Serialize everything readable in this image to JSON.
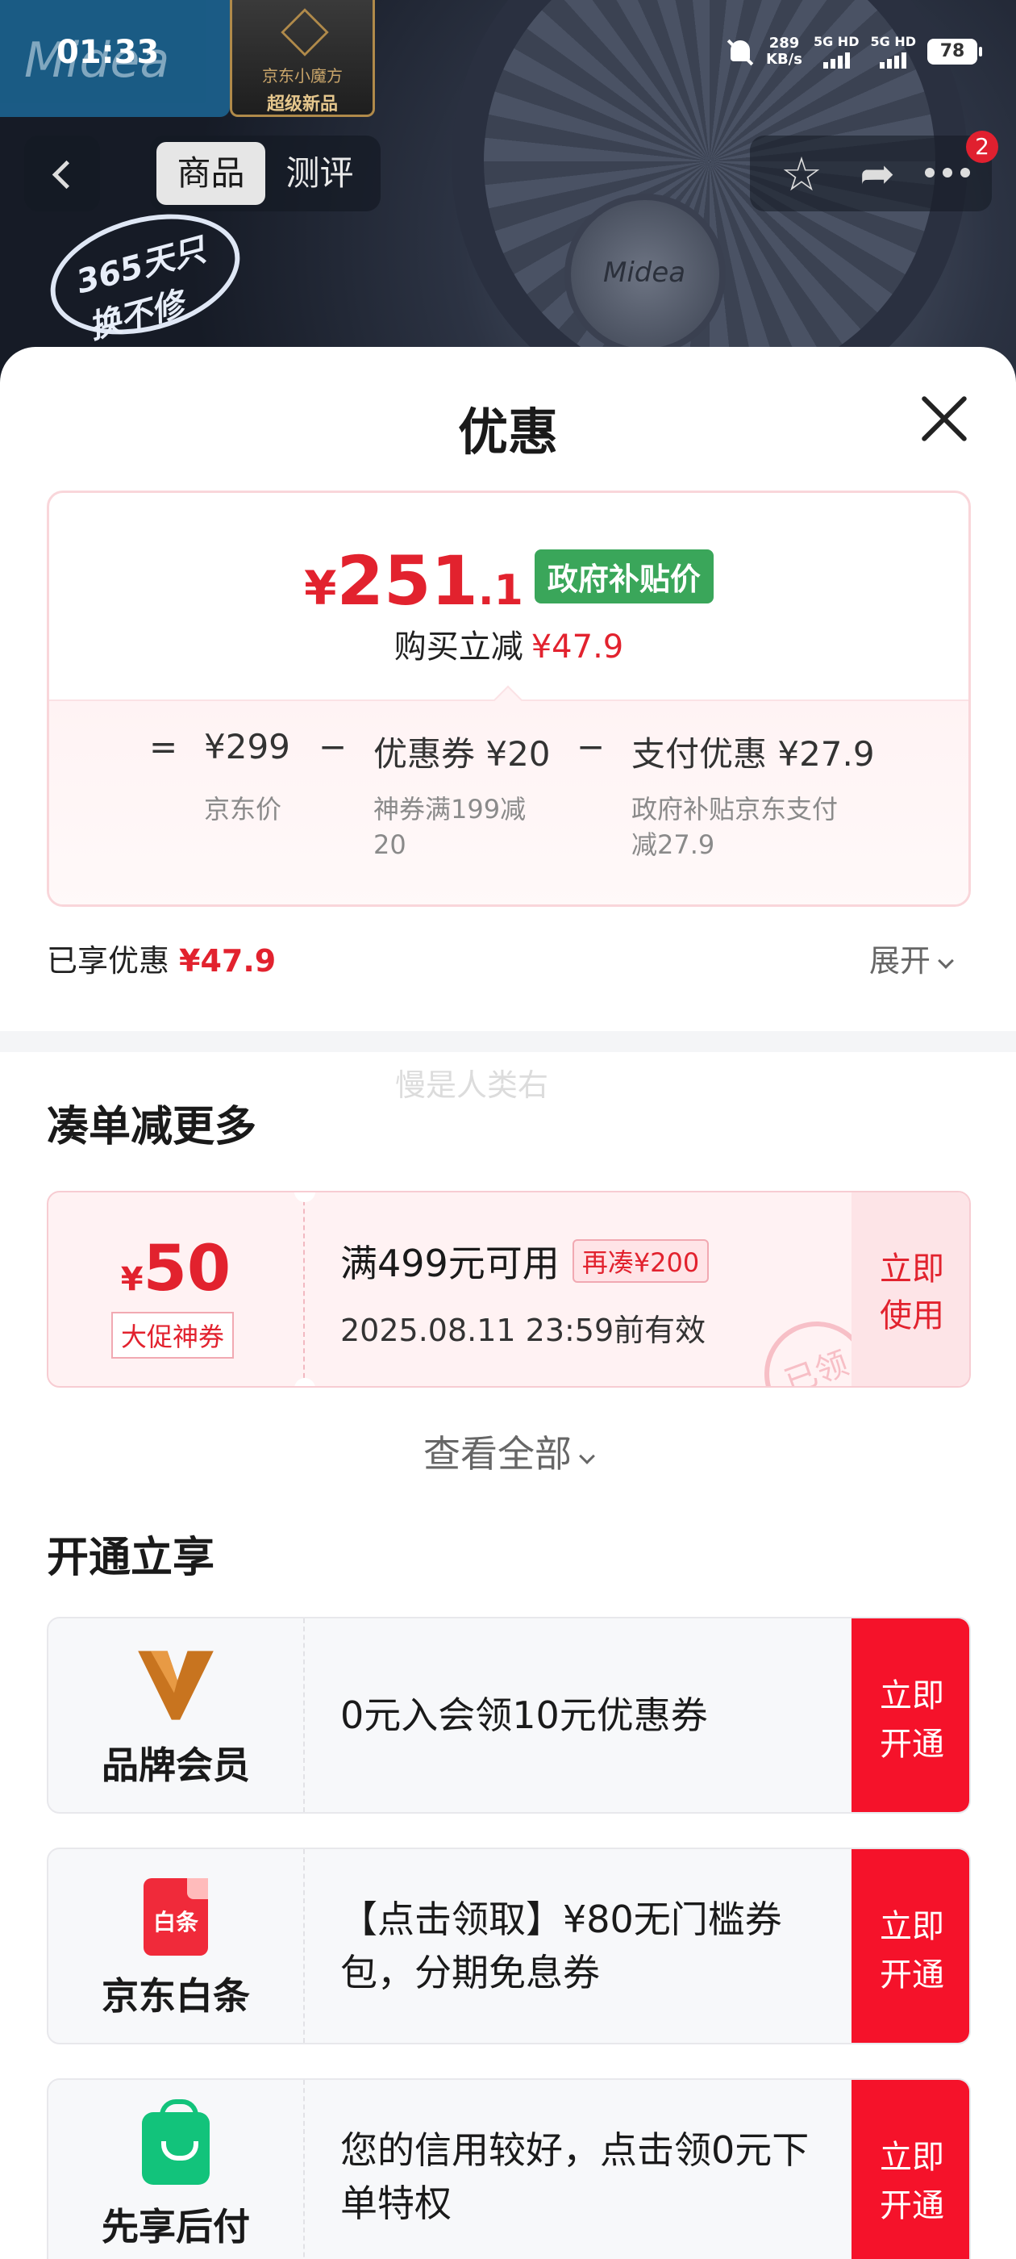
{
  "status_bar": {
    "time": "01:33",
    "net_speed_value": "289",
    "net_speed_unit": "KB/s",
    "sim1": "5G HD",
    "sim2": "5G HD",
    "battery": "78"
  },
  "hero": {
    "brand_text": "Midea",
    "badge_top": "京东小魔方",
    "badge_bottom": "超级新品",
    "promo_text": "365天只换不修",
    "fan_logo": "Midea"
  },
  "nav": {
    "tabs": [
      {
        "label": "商品",
        "active": true
      },
      {
        "label": "测评",
        "active": false
      }
    ],
    "more_badge": "2"
  },
  "sheet": {
    "title": "优惠",
    "price": {
      "yen": "¥",
      "integer": "251",
      "decimal": ".1",
      "tag": "政府补贴价",
      "reduce_label": "购买立减",
      "reduce_value": "¥47.9"
    },
    "formula": {
      "equals": "=",
      "minus": "−",
      "base_price": "¥299",
      "base_label": "京东价",
      "coupon": "优惠券 ¥20",
      "coupon_desc_line1": "神券满199减",
      "coupon_desc_line2": "20",
      "pay": "支付优惠 ¥27.9",
      "pay_desc_line1": "政府补贴京东支付",
      "pay_desc_line2": "减27.9"
    },
    "enjoyed_label": "已享优惠",
    "enjoyed_value": "¥47.9",
    "expand_label": "展开",
    "watermark": "慢是人类右"
  },
  "more_section": {
    "title": "凑单减更多",
    "coupon": {
      "yen": "¥",
      "amount": "50",
      "tag": "大促神券",
      "condition": "满499元可用",
      "more": "再凑¥200",
      "expiry": "2025.08.11 23:59前有效",
      "button_line1": "立即",
      "button_line2": "使用",
      "stamp": "已领"
    },
    "view_all": "查看全部"
  },
  "open_section": {
    "title": "开通立享",
    "cards": [
      {
        "name": "品牌会员",
        "text": "0元入会领10元优惠券",
        "btn1": "立即",
        "btn2": "开通",
        "icon": "v-icon"
      },
      {
        "name": "京东白条",
        "text": "【点击领取】¥80无门槛券包，分期免息券",
        "btn1": "立即",
        "btn2": "开通",
        "icon": "baitiao-icon",
        "icon_text": "白条"
      },
      {
        "name": "先享后付",
        "text": "您的信用较好，点击领0元下单特权",
        "btn1": "立即",
        "btn2": "开通",
        "icon": "bag-icon"
      }
    ]
  },
  "colors": {
    "accent_red": "#e2222e",
    "button_red": "#f5122a",
    "gov_green": "#3aa65a"
  }
}
